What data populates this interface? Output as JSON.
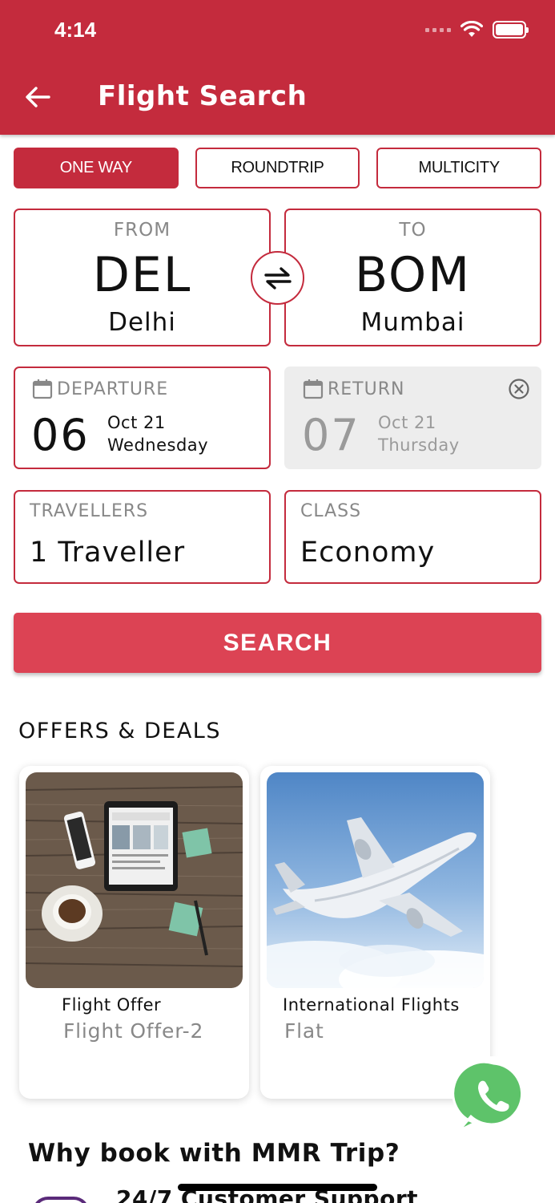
{
  "status_bar": {
    "time": "4:14"
  },
  "header": {
    "title": "Flight Search",
    "accent_color": "#c42b3d"
  },
  "trip_types": [
    {
      "label": "ONE WAY",
      "selected": true
    },
    {
      "label": "ROUNDTRIP",
      "selected": false
    },
    {
      "label": "MULTICITY",
      "selected": false
    }
  ],
  "from": {
    "label": "FROM",
    "code": "DEL",
    "city": "Delhi"
  },
  "to": {
    "label": "TO",
    "code": "BOM",
    "city": "Mumbai"
  },
  "departure": {
    "label": "DEPARTURE",
    "day": "06",
    "month": "Oct 21",
    "weekday": "Wednesday"
  },
  "return": {
    "label": "RETURN",
    "day": "07",
    "month": "Oct 21",
    "weekday": "Thursday"
  },
  "travellers": {
    "label": "TRAVELLERS",
    "value": "1 Traveller"
  },
  "travel_class": {
    "label": "CLASS",
    "value": "Economy"
  },
  "search_button": {
    "label": "SEARCH",
    "color": "#dc4354"
  },
  "offers": {
    "title": "OFFERS & DEALS",
    "items": [
      {
        "title": "Flight Offer",
        "subtitle": "Flight Offer-2",
        "image": "tablet-desk-photo"
      },
      {
        "title": "International Flights",
        "subtitle": "Flat",
        "image": "airplane-sky-photo"
      }
    ]
  },
  "why_book": {
    "title": "Why book with MMR Trip?",
    "first_item": "24/7 Customer Support"
  },
  "icons": [
    "back-arrow-icon",
    "swap-icon",
    "calendar-icon",
    "clear-icon",
    "whatsapp-icon",
    "wifi-icon",
    "battery-icon"
  ]
}
